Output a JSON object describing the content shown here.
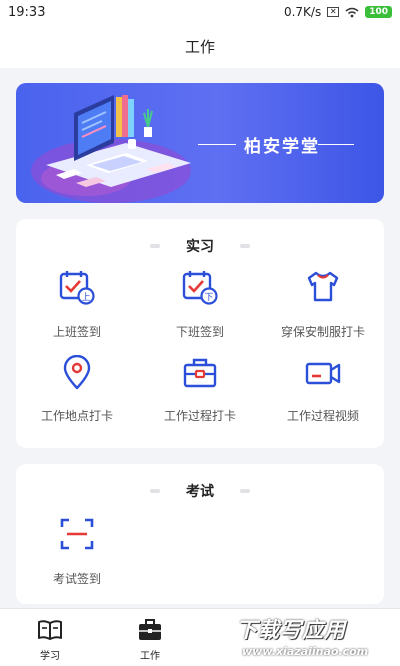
{
  "status_bar": {
    "time": "19:33",
    "speed": "0.7K/s",
    "battery": "100"
  },
  "header": {
    "title": "工作"
  },
  "banner": {
    "title": "柏安学堂"
  },
  "internship": {
    "title": "实习",
    "items": [
      {
        "label": "上班签到",
        "icon": "clock-in-calendar-icon"
      },
      {
        "label": "下班签到",
        "icon": "clock-out-calendar-icon"
      },
      {
        "label": "穿保安制服打卡",
        "icon": "uniform-shirt-icon"
      },
      {
        "label": "工作地点打卡",
        "icon": "location-pin-icon"
      },
      {
        "label": "工作过程打卡",
        "icon": "briefcase-icon"
      },
      {
        "label": "工作过程视频",
        "icon": "video-camera-icon"
      }
    ]
  },
  "exam": {
    "title": "考试",
    "items": [
      {
        "label": "考试签到",
        "icon": "scan-icon"
      }
    ]
  },
  "tab_bar": {
    "tabs": [
      {
        "label": "学习",
        "icon": "book-icon"
      },
      {
        "label": "工作",
        "icon": "briefcase-icon"
      }
    ]
  },
  "watermark": {
    "text": "下载写应用",
    "url": "www.xiazaiinao.com"
  },
  "colors": {
    "accent": "#3f58e8",
    "icon_blue": "#2b4fd8",
    "icon_red": "#e53935"
  }
}
